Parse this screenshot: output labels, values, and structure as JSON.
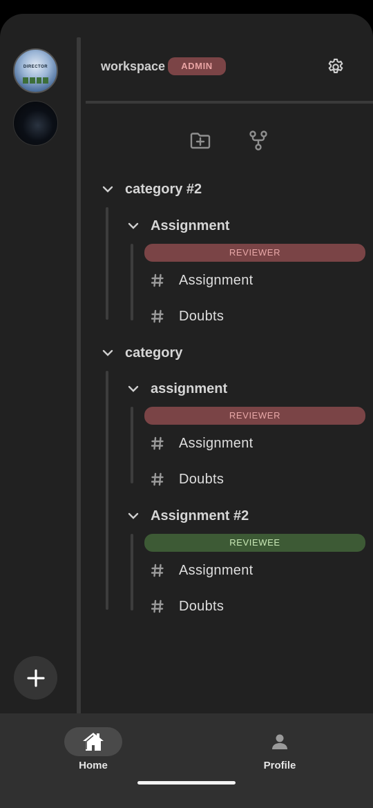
{
  "header": {
    "workspace_name": "workspace",
    "role_badge": "ADMIN"
  },
  "toolbar": {
    "create_category_icon": "folder-plus-icon",
    "create_channel_icon": "fork-icon"
  },
  "sidebar": {
    "workspaces": [
      {
        "icon": "workspace-avatar-image",
        "caption": "DIRECTOR"
      },
      {
        "icon": "workspace-avatar-dark"
      }
    ]
  },
  "tree": {
    "categories": [
      {
        "name": "category #2",
        "groups": [
          {
            "name": "Assignment",
            "role": "REVIEWER",
            "channels": [
              "Assignment",
              "Doubts"
            ]
          }
        ]
      },
      {
        "name": "category",
        "groups": [
          {
            "name": "assignment",
            "role": "REVIEWER",
            "channels": [
              "Assignment",
              "Doubts"
            ]
          },
          {
            "name": "Assignment #2",
            "role": "REVIEWEE",
            "channels": [
              "Assignment",
              "Doubts"
            ]
          }
        ]
      }
    ]
  },
  "nav": {
    "home_label": "Home",
    "profile_label": "Profile"
  },
  "colors": {
    "background": "#212121",
    "reviewer_badge": "#7a4446",
    "reviewee_badge": "#3d5a35",
    "admin_badge": "#7b4446"
  }
}
